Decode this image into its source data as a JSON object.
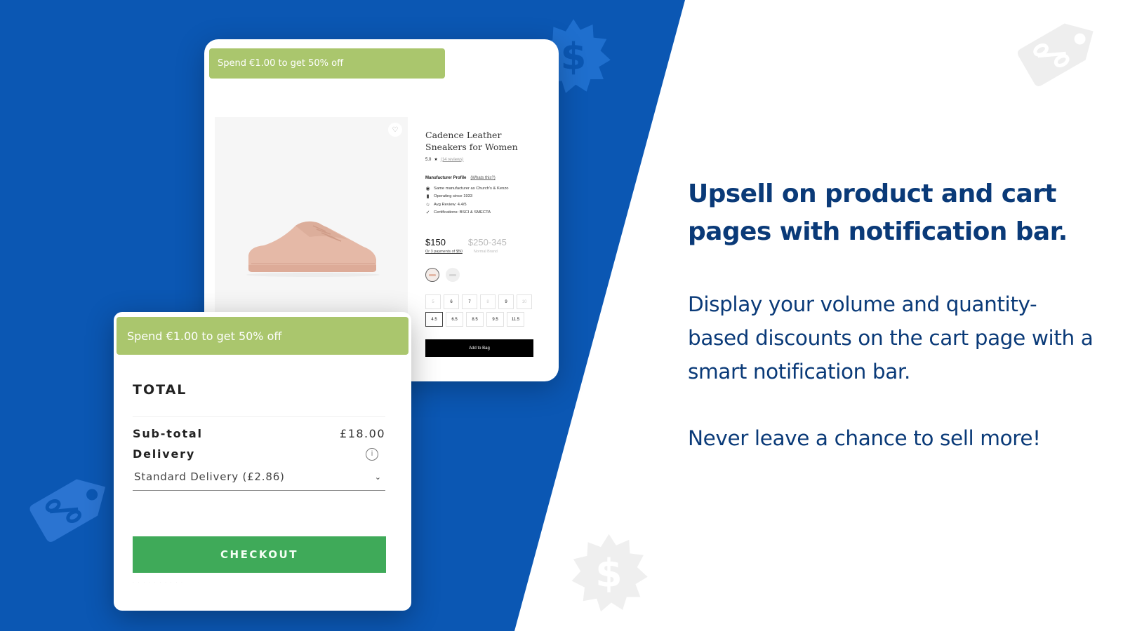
{
  "colors": {
    "background_blue": "#0b57b3",
    "notification_green": "#aac66d",
    "checkout_green": "#3faa59",
    "headline_navy": "#0a3a78"
  },
  "decorations": [
    {
      "icon": "dollar-badge-icon",
      "tone": "blue"
    },
    {
      "icon": "percent-tag-icon",
      "tone": "light-grey"
    },
    {
      "icon": "percent-tag-icon",
      "tone": "blue"
    },
    {
      "icon": "dollar-badge-icon",
      "tone": "light-grey"
    }
  ],
  "product_page": {
    "notification": "Spend €1.00 to get 50% off",
    "wishlist_icon": "heart-icon",
    "title": "Cadence Leather Sneakers for Women",
    "rating": {
      "score": "5.0",
      "star": "★",
      "reviews": "(14 reviews)"
    },
    "manufacturer": {
      "heading": "Manufacturer Profile",
      "link": "(Whats this?)",
      "items": [
        {
          "icon": "eye-icon",
          "glyph": "👁",
          "text": "Same manufacturer as Church's & Kenzo"
        },
        {
          "icon": "person-icon",
          "glyph": "🛉",
          "text": "Operating since 1933"
        },
        {
          "icon": "star-outline-icon",
          "glyph": "☆",
          "text": "Avg Review: 4.4/5"
        },
        {
          "icon": "check-icon",
          "glyph": "✓",
          "text": "Certifications: BSCI & SMECTA"
        }
      ]
    },
    "price": "$150",
    "installments": "Or 3 payments of $50",
    "normal_price": "$250-345",
    "normal_label": "Normal Brand",
    "sizes_row1": [
      {
        "label": "5",
        "state": "disabled"
      },
      {
        "label": "6",
        "state": "available"
      },
      {
        "label": "7",
        "state": "available"
      },
      {
        "label": "8",
        "state": "disabled"
      },
      {
        "label": "9",
        "state": "available"
      },
      {
        "label": "10",
        "state": "disabled"
      }
    ],
    "sizes_row2": [
      {
        "label": "4.5",
        "state": "selected"
      },
      {
        "label": "6.5",
        "state": "available"
      },
      {
        "label": "8.5",
        "state": "available"
      },
      {
        "label": "9.5",
        "state": "available"
      },
      {
        "label": "11.5",
        "state": "available"
      }
    ],
    "add_to_bag": "Add to Bag"
  },
  "cart": {
    "notification": "Spend €1.00 to get 50% off",
    "total_title": "TOTAL",
    "subtotal_label": "Sub-total",
    "subtotal_value": "£18.00",
    "delivery_label": "Delivery",
    "delivery_info_icon": "info-icon",
    "delivery_option": "Standard Delivery (£2.86)",
    "checkout": "CHECKOUT"
  },
  "copy": {
    "headline": "Upsell on product and cart pages with notification bar.",
    "body": "Display your volume and quantity-based discounts on the cart page with a smart notification bar.",
    "tagline": "Never leave a chance to sell more!"
  }
}
